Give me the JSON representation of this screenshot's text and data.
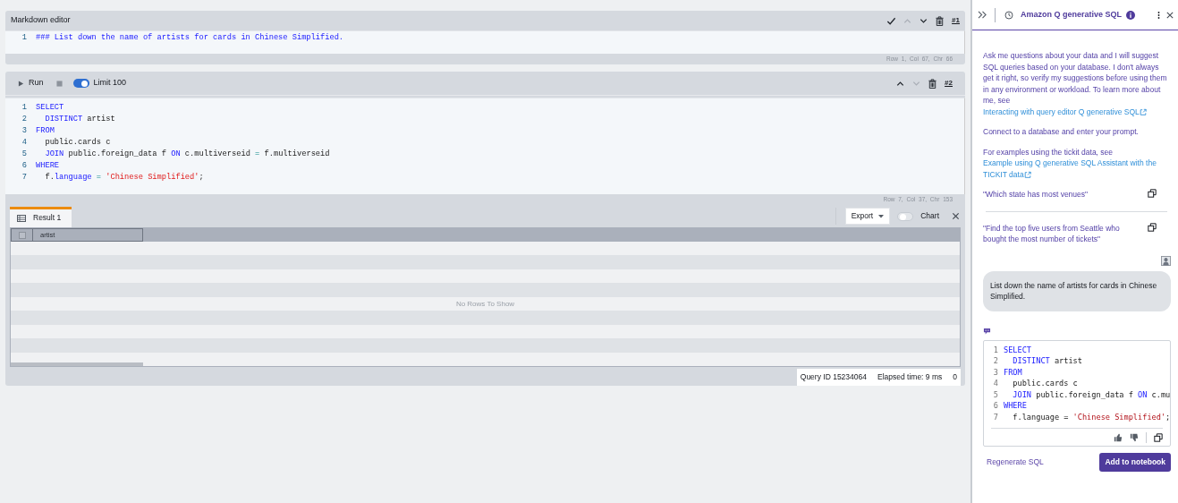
{
  "notebook": {
    "cells": [
      {
        "kind": "markdown",
        "title": "Markdown editor",
        "actions": [
          {
            "kind": "check",
            "disabled": false
          },
          {
            "kind": "up",
            "disabled": true
          },
          {
            "kind": "down",
            "disabled": false
          },
          {
            "kind": "delete",
            "disabled": false
          }
        ],
        "number": "#1",
        "lines": [
          {
            "number": "1",
            "tokens": [
              {
                "kind": "heading",
                "text": "### List down the name of artists for cards in Chinese Simplified."
              }
            ]
          }
        ],
        "status": "Row 1, Col 67, Chr 66"
      },
      {
        "kind": "sql",
        "run_label": "Run",
        "limit": {
          "label": "Limit 100",
          "on": true
        },
        "actions": [
          {
            "kind": "up",
            "disabled": false
          },
          {
            "kind": "down",
            "disabled": true
          },
          {
            "kind": "delete",
            "disabled": false
          }
        ],
        "number": "#2",
        "lines": [
          {
            "number": "1",
            "tokens": [
              {
                "kind": "kw",
                "text": "SELECT"
              }
            ]
          },
          {
            "number": "2",
            "tokens": [
              {
                "kind": "kw",
                "text": "  DISTINCT"
              },
              {
                "kind": "plain",
                "text": " artist"
              }
            ]
          },
          {
            "number": "3",
            "tokens": [
              {
                "kind": "kw",
                "text": "FROM"
              }
            ]
          },
          {
            "number": "4",
            "tokens": [
              {
                "kind": "plain",
                "text": "  public.cards c"
              }
            ]
          },
          {
            "number": "5",
            "tokens": [
              {
                "kind": "kw",
                "text": "  JOIN"
              },
              {
                "kind": "plain",
                "text": " public.foreign_data f "
              },
              {
                "kind": "kw",
                "text": "ON"
              },
              {
                "kind": "plain",
                "text": " c.multiverseid "
              },
              {
                "kind": "op",
                "text": "="
              },
              {
                "kind": "plain",
                "text": " f.multiverseid"
              }
            ]
          },
          {
            "number": "6",
            "tokens": [
              {
                "kind": "kw",
                "text": "WHERE"
              }
            ]
          },
          {
            "number": "7",
            "tokens": [
              {
                "kind": "plain",
                "text": "  f."
              },
              {
                "kind": "prop",
                "text": "language"
              },
              {
                "kind": "op",
                "text": " = "
              },
              {
                "kind": "str",
                "text": "'Chinese Simplified'"
              },
              {
                "kind": "plain",
                "text": ";"
              }
            ]
          }
        ],
        "status": "Row 7, Col 37, Chr 153",
        "result": {
          "tabs": [
            {
              "label": "Result 1",
              "selected": true
            }
          ],
          "export": "Export",
          "chart": {
            "label": "Chart",
            "on": false
          },
          "select_all_checked": false,
          "columns": [
            "artist"
          ],
          "empty_message": "No Rows To Show",
          "query_id": "Query ID 15234064",
          "elapsed": "Elapsed time: 9 ms",
          "footer_3": "0"
        }
      }
    ]
  },
  "q_panel": {
    "title": "Amazon Q generative SQL",
    "intro": {
      "text": "Ask me questions about your data and I will suggest SQL queries based on your database. I don't always get it right, so verify my suggestions before using them in any environment or workload. To learn more about me, see ",
      "link": "Interacting with query editor Q generative SQL"
    },
    "connect_hint": "Connect to a database and enter your prompt.",
    "examples_intro": {
      "text": "For examples using the tickit data, see ",
      "link": "Example using Q generative SQL Assistant with the TICKIT data"
    },
    "examples": [
      "\"Which state has most venues\"",
      "\"Find the top five users from Seattle who bought the most number of tickets\""
    ],
    "messages": [
      {
        "kind": "user",
        "text": "List down the name of artists for cards in Chinese Simplified."
      },
      {
        "kind": "assistant",
        "lines": [
          {
            "number": "1",
            "tokens": [
              {
                "kind": "kw",
                "text": "SELECT"
              }
            ]
          },
          {
            "number": "2",
            "tokens": [
              {
                "kind": "kw",
                "text": "  DISTINCT"
              },
              {
                "kind": "plain",
                "text": " artist"
              }
            ]
          },
          {
            "number": "3",
            "tokens": [
              {
                "kind": "kw",
                "text": "FROM"
              }
            ]
          },
          {
            "number": "4",
            "tokens": [
              {
                "kind": "plain",
                "text": "  public.cards c"
              }
            ]
          },
          {
            "number": "5",
            "tokens": [
              {
                "kind": "kw",
                "text": "  JOIN"
              },
              {
                "kind": "plain",
                "text": " public.foreign_data f "
              },
              {
                "kind": "kw",
                "text": "ON"
              },
              {
                "kind": "plain",
                "text": " c.mu"
              }
            ]
          },
          {
            "number": "6",
            "tokens": [
              {
                "kind": "kw",
                "text": "WHERE"
              }
            ]
          },
          {
            "number": "7",
            "tokens": [
              {
                "kind": "plain",
                "text": "  f.language = "
              },
              {
                "kind": "str",
                "text": "'Chinese Simplified'"
              },
              {
                "kind": "plain",
                "text": ";"
              }
            ]
          }
        ]
      }
    ],
    "regenerate": "Regenerate SQL",
    "add_button": "Add to notebook"
  }
}
